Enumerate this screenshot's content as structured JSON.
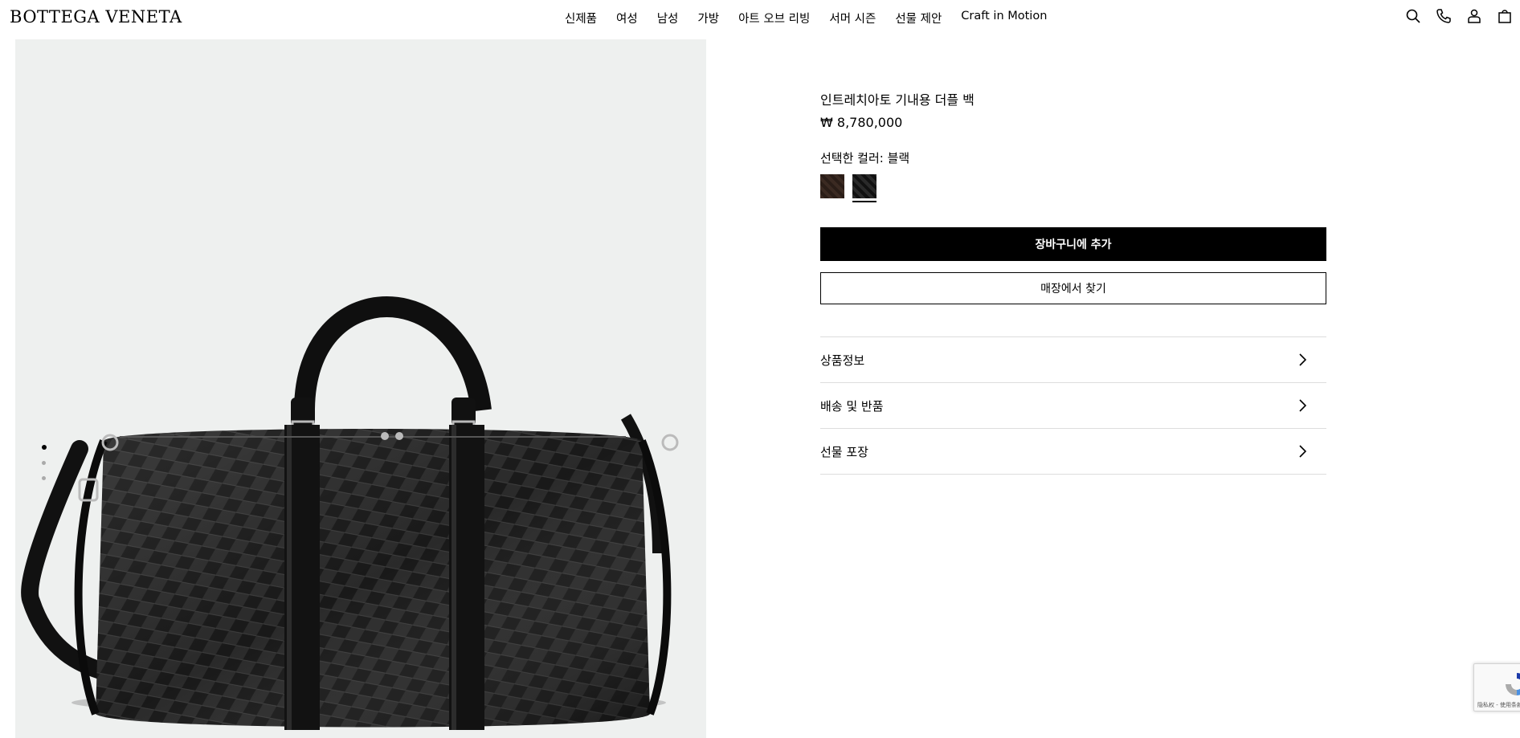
{
  "brand": {
    "logo": "BOTTEGA VENETA"
  },
  "nav": {
    "items": [
      "신제품",
      "여성",
      "남성",
      "가방",
      "아트 오브 리빙",
      "서머 시즌",
      "선물 제안",
      "Craft in Motion"
    ]
  },
  "header_icons": [
    "search-icon",
    "phone-icon",
    "account-icon",
    "bag-icon"
  ],
  "gallery": {
    "slides": 3,
    "active_slide": 1
  },
  "product": {
    "name": "인트레치아토 기내용 더플 백",
    "price": "₩ 8,780,000",
    "color_label": "선택한 컬러: 블랙",
    "swatches": [
      {
        "name": "brown",
        "color": "#3b2a22",
        "selected": false
      },
      {
        "name": "black",
        "color": "#1a1a1a",
        "selected": true
      }
    ]
  },
  "actions": {
    "add_to_cart": "장바구니에 추가",
    "find_in_store": "매장에서 찾기"
  },
  "accordion": [
    {
      "label": "상품정보"
    },
    {
      "label": "배송 및 반품"
    },
    {
      "label": "선물 포장"
    }
  ],
  "recaptcha": {
    "text": "隐私权 - 使用条款"
  }
}
